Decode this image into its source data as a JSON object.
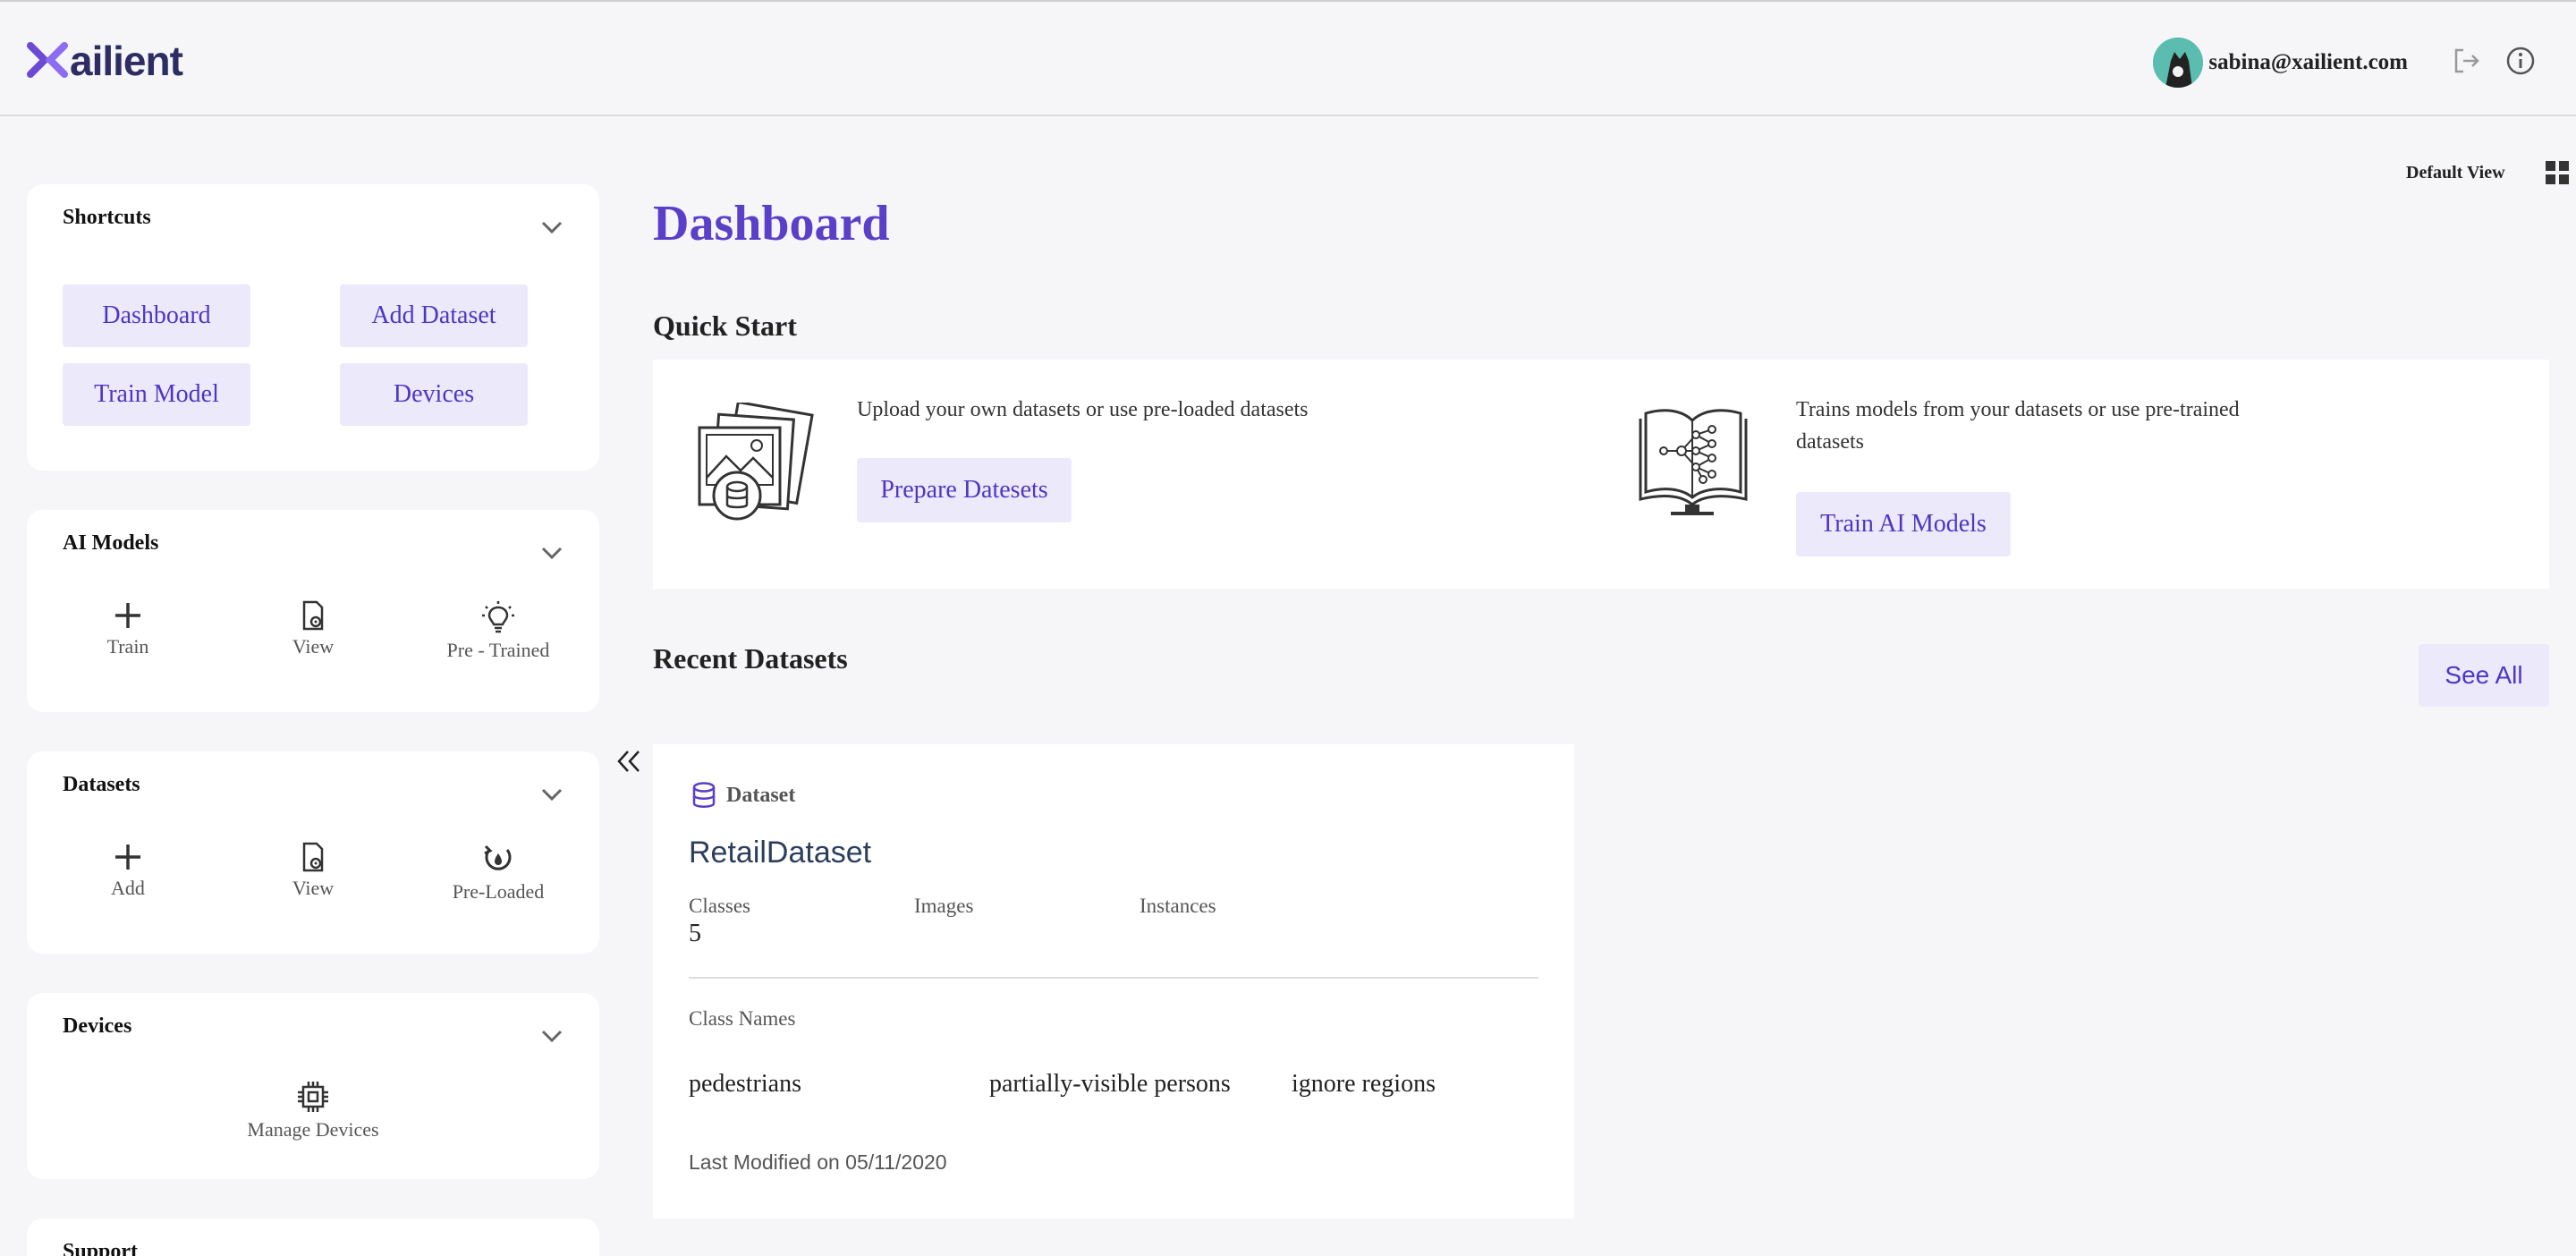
{
  "header": {
    "logo_text": "ailient",
    "user_email": "sabina@xailient.com",
    "logout_icon": "logout-icon",
    "info_icon": "info-icon",
    "brand_color": "#5a3fc9"
  },
  "sidebar": {
    "shortcuts": {
      "title": "Shortcuts",
      "buttons": [
        "Dashboard",
        "Add Dataset",
        "Train Model",
        "Devices"
      ]
    },
    "ai_models": {
      "title": "AI Models",
      "tools": [
        {
          "label": "Train",
          "icon": "plus-icon"
        },
        {
          "label": "View",
          "icon": "file-view-icon"
        },
        {
          "label": "Pre - Trained",
          "icon": "lightbulb-icon"
        }
      ]
    },
    "datasets": {
      "title": "Datasets",
      "tools": [
        {
          "label": "Add",
          "icon": "plus-icon"
        },
        {
          "label": "View",
          "icon": "file-view-icon"
        },
        {
          "label": "Pre-Loaded",
          "icon": "refresh-icon"
        }
      ]
    },
    "devices": {
      "title": "Devices",
      "tools": [
        {
          "label": "Manage Devices",
          "icon": "chip-icon"
        }
      ]
    },
    "support": {
      "title": "Support"
    }
  },
  "main": {
    "view_label": "Default View",
    "title": "Dashboard",
    "quick_start": {
      "title": "Quick Start",
      "items": [
        {
          "text": "Upload your own datasets or use pre-loaded datasets",
          "button": "Prepare Datesets"
        },
        {
          "text": "Trains models from your datasets or use pre-trained datasets",
          "button": "Train AI Models"
        }
      ]
    },
    "recent_datasets": {
      "title": "Recent Datasets",
      "see_all": "See All",
      "card": {
        "tag": "Dataset",
        "name": "RetailDataset",
        "columns": [
          {
            "label": "Classes",
            "value": "5"
          },
          {
            "label": "Images",
            "value": ""
          },
          {
            "label": "Instances",
            "value": ""
          }
        ],
        "class_names_label": "Class Names",
        "class_names": [
          "pedestrians",
          "partially-visible persons",
          "ignore regions"
        ],
        "last_modified": "Last Modified on 05/11/2020"
      }
    }
  }
}
